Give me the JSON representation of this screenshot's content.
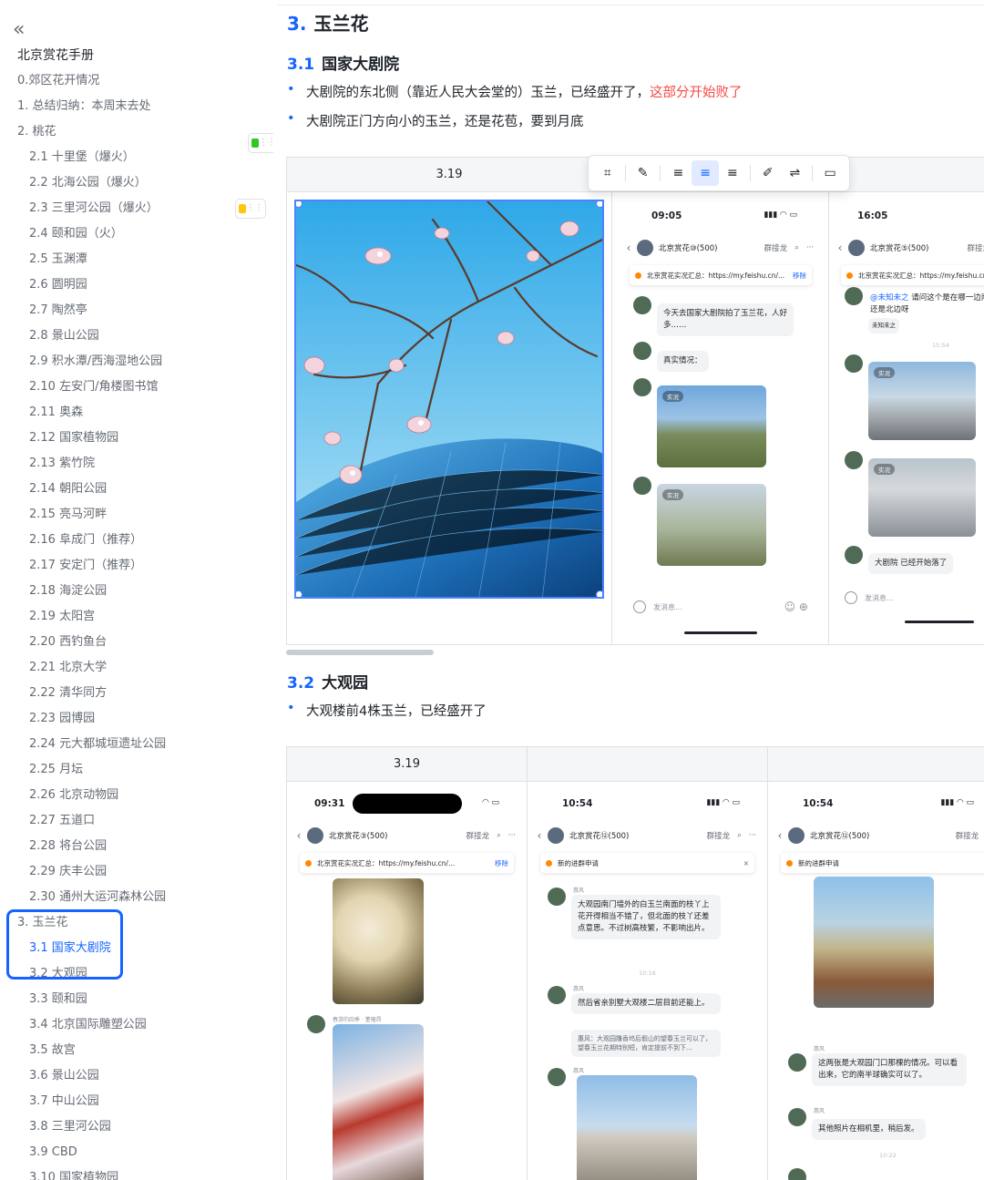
{
  "sidebar": {
    "toc": [
      {
        "label": "北京赏花手册",
        "level": 1,
        "type": "title"
      },
      {
        "label": "0.郊区花开情况",
        "level": 1
      },
      {
        "label": "1. 总结归纳：本周末去处",
        "level": 1
      },
      {
        "label": "2. 桃花",
        "level": 1
      },
      {
        "label": "2.1 十里堡（爆火）",
        "level": 2
      },
      {
        "label": "2.2 北海公园（爆火）",
        "level": 2
      },
      {
        "label": "2.3 三里河公园（爆火）",
        "level": 2
      },
      {
        "label": "2.4 颐和园（火）",
        "level": 2
      },
      {
        "label": "2.5 玉渊潭",
        "level": 2
      },
      {
        "label": "2.6 圆明园",
        "level": 2
      },
      {
        "label": "2.7 陶然亭",
        "level": 2
      },
      {
        "label": "2.8 景山公园",
        "level": 2
      },
      {
        "label": "2.9 积水潭/西海湿地公园",
        "level": 2
      },
      {
        "label": "2.10 左安门/角楼图书馆",
        "level": 2
      },
      {
        "label": "2.11 奥森",
        "level": 2
      },
      {
        "label": "2.12 国家植物园",
        "level": 2
      },
      {
        "label": "2.13 紫竹院",
        "level": 2
      },
      {
        "label": "2.14 朝阳公园",
        "level": 2
      },
      {
        "label": "2.15 亮马河畔",
        "level": 2
      },
      {
        "label": "2.16 阜成门（推荐）",
        "level": 2
      },
      {
        "label": "2.17 安定门（推荐）",
        "level": 2
      },
      {
        "label": "2.18 海淀公园",
        "level": 2
      },
      {
        "label": "2.19 太阳宫",
        "level": 2
      },
      {
        "label": "2.20 西钓鱼台",
        "level": 2
      },
      {
        "label": "2.21 北京大学",
        "level": 2
      },
      {
        "label": "2.22 清华同方",
        "level": 2
      },
      {
        "label": "2.23 园博园",
        "level": 2
      },
      {
        "label": "2.24 元大都城垣遗址公园",
        "level": 2
      },
      {
        "label": "2.25 月坛",
        "level": 2
      },
      {
        "label": "2.26 北京动物园",
        "level": 2
      },
      {
        "label": "2.27 五道口",
        "level": 2
      },
      {
        "label": "2.28 将台公园",
        "level": 2
      },
      {
        "label": "2.29 庆丰公园",
        "level": 2
      },
      {
        "label": "2.30 通州大运河森林公园",
        "level": 2
      },
      {
        "label": "3. 玉兰花",
        "level": 1
      },
      {
        "label": "3.1 国家大剧院",
        "level": 2,
        "active": true
      },
      {
        "label": "3.2 大观园",
        "level": 2
      },
      {
        "label": "3.3 颐和园",
        "level": 2
      },
      {
        "label": "3.4 北京国际雕塑公园",
        "level": 2
      },
      {
        "label": "3.5 故宫",
        "level": 2
      },
      {
        "label": "3.6 景山公园",
        "level": 2
      },
      {
        "label": "3.7 中山公园",
        "level": 2
      },
      {
        "label": "3.8 三里河公园",
        "level": 2
      },
      {
        "label": "3.9 CBD",
        "level": 2
      },
      {
        "label": "3.10 国家植物园",
        "level": 2
      }
    ]
  },
  "content": {
    "section3": {
      "num": "3.",
      "title": "玉兰花"
    },
    "s31": {
      "num": "3.1",
      "title": "国家大剧院",
      "bullet1_main": "大剧院的东北侧（靠近人民大会堂的）玉兰，已经盛开了，",
      "bullet1_red": "这部分开始败了",
      "bullet2": "大剧院正门方向小的玉兰，还是花苞，要到月底"
    },
    "table1": {
      "header": "3.19"
    },
    "s32": {
      "num": "3.2",
      "title": "大观园",
      "bullet1": "大观楼前4株玉兰，已经盛开了"
    },
    "table2": {
      "header": "3.19"
    }
  },
  "phones": {
    "p1": {
      "time": "09:05",
      "group": "北京赏花⑩(500)",
      "group_act": "群接龙",
      "pin": "北京赏花实况汇总：https://my.feishu.cn/...",
      "pin_remove": "移除",
      "msg1": "今天去国家大剧院拍了玉兰花，人好多……",
      "msg2": "真实情况：",
      "tag": "实况",
      "input": "发消息..."
    },
    "p2": {
      "time": "16:05",
      "group": "北京赏花⑤(500)",
      "group_act": "群接龙",
      "pin": "北京赏花实况汇总：https://my.feishu.cn",
      "mention": "@未知未之",
      "msg1": "请问这个是在哪一边南边还是北边呀",
      "reply_sender": "未知未之",
      "sep": "15:54",
      "tag": "实况",
      "msg2": "大剧院 已经开始落了",
      "input": "发消息..."
    },
    "p3": {
      "time": "09:31",
      "group": "北京赏花③(500)",
      "group_act": "群接龙",
      "pin": "北京赏花实况汇总：https://my.feishu.cn/...",
      "pin_remove": "移除",
      "sender": "春游的四季 · 董曈昂"
    },
    "p4": {
      "time": "10:54",
      "group": "北京赏花⑫(500)",
      "group_act": "群接龙",
      "notice": "新的进群申请",
      "close": "×",
      "sender": "惠风",
      "msg1": "大观园南门墙外的白玉兰南面的枝丫上花开得相当不错了，但北面的枝丫还差点意思。不过树高枝繁，不影响出片。",
      "sep": "10:16",
      "msg2": "然后省亲别墅大观楼二层目前还能上。",
      "quote": "惠风：大观园雕香坞后假山的望春玉兰可以了，望春玉兰花期特别短，肯定提前不到下…"
    },
    "p5": {
      "time": "10:54",
      "group": "北京赏花⑫(500)",
      "group_act": "群接龙",
      "notice": "新的进群申请",
      "sender": "惠风",
      "msg1": "这两张是大观园门口那棵的情况。可以看出来，它的南半球确实可以了。",
      "msg2": "其他照片在相机里，稍后发。",
      "sep": "10:22"
    }
  },
  "colors": {
    "accent": "#1664ff",
    "warn": "#f54a45",
    "text": "#1f2329",
    "muted": "#646a73"
  }
}
